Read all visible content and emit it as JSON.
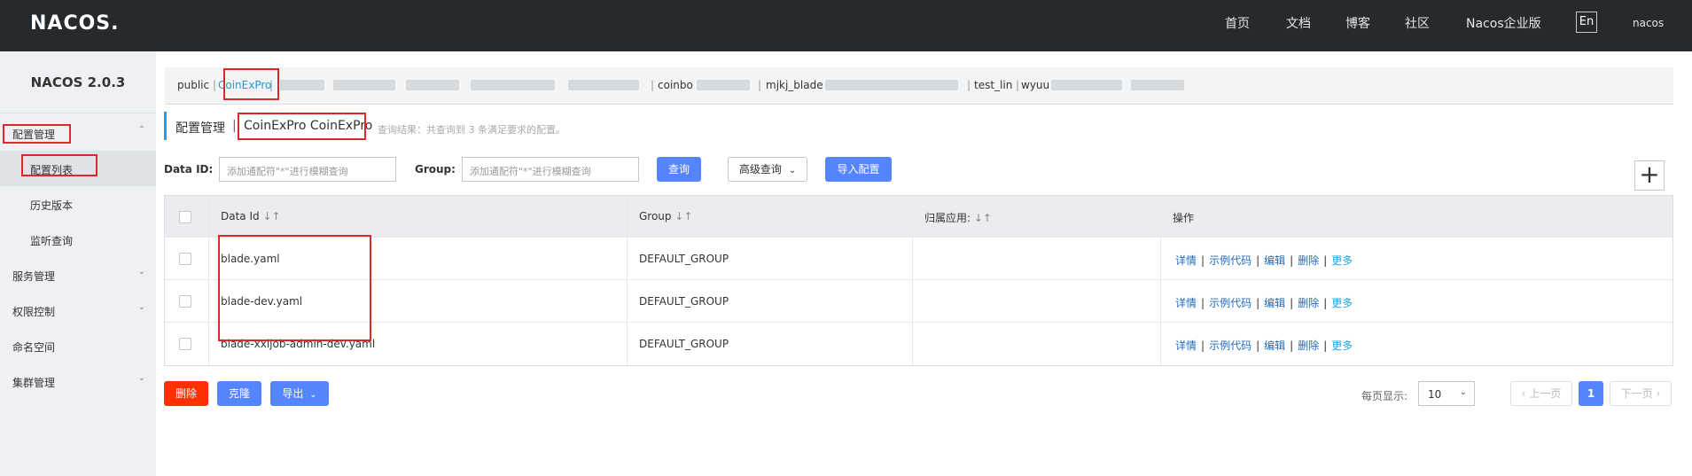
{
  "header": {
    "logo_text": "NACOS.",
    "nav": [
      "首页",
      "文档",
      "博客",
      "社区",
      "Nacos企业版"
    ],
    "lang": "En",
    "user": "nacos"
  },
  "sidebar": {
    "version": "NACOS 2.0.3",
    "items": [
      {
        "label": "配置管理",
        "expandable": true
      },
      {
        "label": "配置列表",
        "sub": true,
        "active": true
      },
      {
        "label": "历史版本",
        "sub": true
      },
      {
        "label": "监听查询",
        "sub": true
      },
      {
        "label": "服务管理",
        "expandable": true
      },
      {
        "label": "权限控制",
        "expandable": true
      },
      {
        "label": "命名空间"
      },
      {
        "label": "集群管理",
        "expandable": true
      }
    ]
  },
  "namespaces": {
    "items": [
      "public",
      "CoinExPro",
      "coinbo",
      "mjkj_blade",
      "test_lin",
      "wyuu"
    ],
    "active": "CoinExPro"
  },
  "main": {
    "title": "配置管理",
    "separator": "|",
    "namespace_title": "CoinExPro  CoinExPro",
    "query_result": "查询结果：共查询到 3 条满足要求的配置。"
  },
  "search": {
    "data_id_label": "Data ID:",
    "data_id_placeholder": "添加通配符\"*\"进行模糊查询",
    "group_label": "Group:",
    "group_placeholder": "添加通配符\"*\"进行模糊查询",
    "query_button": "查询",
    "advanced_button": "高级查询",
    "import_button": "导入配置",
    "add_button": "+"
  },
  "table": {
    "headers": [
      "Data Id",
      "Group",
      "归属应用:",
      "操作"
    ],
    "rows": [
      {
        "data_id": "blade.yaml",
        "group": "DEFAULT_GROUP",
        "app": ""
      },
      {
        "data_id": "blade-dev.yaml",
        "group": "DEFAULT_GROUP",
        "app": ""
      },
      {
        "data_id": "blade-xxljob-admin-dev.yaml",
        "group": "DEFAULT_GROUP",
        "app": ""
      }
    ],
    "actions": [
      "详情",
      "示例代码",
      "编辑",
      "删除",
      "更多"
    ]
  },
  "footer": {
    "delete_button": "删除",
    "clone_button": "克隆",
    "export_button": "导出",
    "per_page_label": "每页显示:",
    "per_page_value": "10",
    "prev_button": "上一页",
    "current_page": "1",
    "next_button": "下一页"
  },
  "colors": {
    "header_bg": "#252a2f",
    "sidebar_bg": "#eef0f3",
    "primary": "#5584ff",
    "danger": "#ff3000",
    "link": "#1f6bc2",
    "highlight_box": "#e0252c"
  }
}
